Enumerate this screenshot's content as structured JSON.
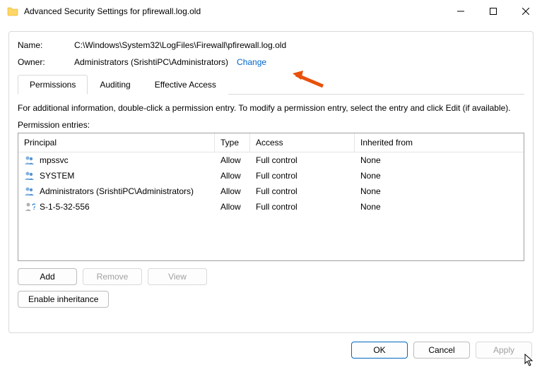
{
  "window": {
    "title": "Advanced Security Settings for pfirewall.log.old"
  },
  "fields": {
    "name_label": "Name:",
    "name_value": "C:\\Windows\\System32\\LogFiles\\Firewall\\pfirewall.log.old",
    "owner_label": "Owner:",
    "owner_value": "Administrators (SrishtiPC\\Administrators)",
    "change_link": "Change"
  },
  "tabs": {
    "permissions": "Permissions",
    "auditing": "Auditing",
    "effective": "Effective Access"
  },
  "info_text": "For additional information, double-click a permission entry. To modify a permission entry, select the entry and click Edit (if available).",
  "section_label": "Permission entries:",
  "table": {
    "headers": {
      "principal": "Principal",
      "type": "Type",
      "access": "Access",
      "inherited": "Inherited from"
    },
    "rows": [
      {
        "icon": "group",
        "principal": "mpssvc",
        "type": "Allow",
        "access": "Full control",
        "inherited": "None"
      },
      {
        "icon": "group",
        "principal": "SYSTEM",
        "type": "Allow",
        "access": "Full control",
        "inherited": "None"
      },
      {
        "icon": "group",
        "principal": "Administrators (SrishtiPC\\Administrators)",
        "type": "Allow",
        "access": "Full control",
        "inherited": "None"
      },
      {
        "icon": "unknown",
        "principal": "S-1-5-32-556",
        "type": "Allow",
        "access": "Full control",
        "inherited": "None"
      }
    ]
  },
  "buttons": {
    "add": "Add",
    "remove": "Remove",
    "view": "View",
    "enable_inheritance": "Enable inheritance",
    "ok": "OK",
    "cancel": "Cancel",
    "apply": "Apply"
  }
}
